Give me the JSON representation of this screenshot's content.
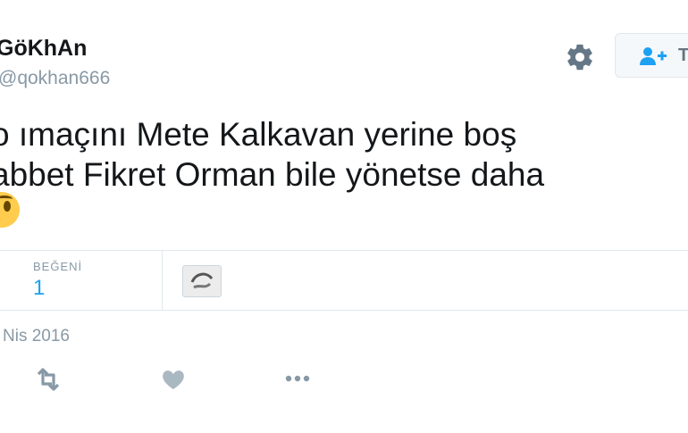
{
  "author": {
    "display_name": "GöKhAn",
    "handle": "@qokhan666"
  },
  "header": {
    "follow_label": "T"
  },
  "tweet": {
    "lines": [
      "o ımaçını Mete Kalkavan yerine boş",
      "abbet Fikret Orman bile yönetse daha"
    ],
    "emoji": "fearful-face-emoji"
  },
  "stats": {
    "likes_label": "BEĞENİ",
    "likes_count": "1"
  },
  "meta": {
    "date": "Nis 2016"
  },
  "actions": [
    "retweet-icon",
    "like-icon",
    "more-icon"
  ],
  "colors": {
    "text": "#14171a",
    "muted": "#8899a6",
    "accent": "#1da1f2",
    "border": "#e1e8ed"
  }
}
